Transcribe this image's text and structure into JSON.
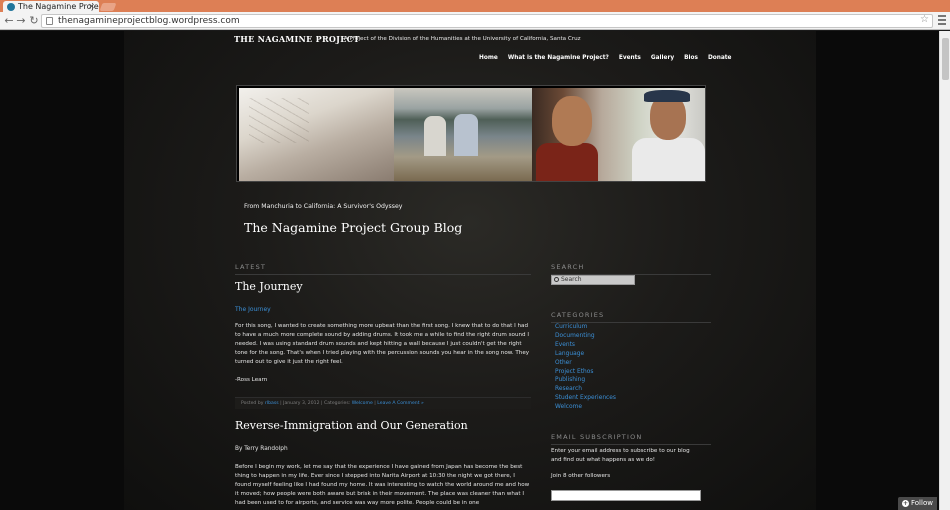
{
  "browser": {
    "tab_title": "The Nagamine Proje",
    "url": "thenagamineprojectblog.wordpress.com",
    "tab_strip_color": "#dd7f55"
  },
  "site": {
    "title": "THE NAGAMINE PROJECT",
    "description": "A Project of the Division of the Humanities at the University of California, Santa Cruz",
    "nav": [
      "Home",
      "What is the Nagamine Project?",
      "Events",
      "Gallery",
      "Bios",
      "Donate"
    ],
    "tagline": "From Manchuria to California: A Survivor's Odyssey",
    "blog_title": "The Nagamine Project Group Blog",
    "link_color": "#3b8fd6"
  },
  "main": {
    "section_label": "LATEST",
    "post1": {
      "title": "The Journey",
      "subtitle": "The Journey",
      "body": "For this song, I wanted to create something more upbeat than the first song. I knew that to do that I had to have a much more complete sound by adding drums. It took me a while to find the right drum sound I needed. I was using standard drum sounds and kept hitting a wall because I just couldn't get the right tone for the song. That's when I tried playing with the percussion sounds you hear in the song now. They turned out to give it just the right feel.",
      "signature": "-Ross Learn",
      "meta_posted_by": "Posted by",
      "meta_author": "rlbass",
      "meta_date": "January 3, 2012",
      "meta_categories_label": "Categories:",
      "meta_category": "Welcome",
      "meta_comment": "Leave A Comment »"
    },
    "post2": {
      "title": "Reverse-Immigration and Our Generation",
      "byline": "By Terry Randolph",
      "body": "Before I begin my work, let me say that the experience I have gained from Japan has become the best thing to happen in my life.  Ever since I stepped into Narita Airport at 10:30 the night we got there, I found myself feeling like I had found my home. It was interesting to watch the world around me and how it moved; how people were both aware but brisk in their movement. The place was cleaner than what I had been used to for airports, and service was way more polite. People could be in one"
    }
  },
  "sidebar": {
    "search_label": "SEARCH",
    "search_placeholder": "Search",
    "categories_label": "CATEGORIES",
    "categories": [
      "Curriculum",
      "Documenting",
      "Events",
      "Language",
      "Other",
      "Project Ethos",
      "Publishing",
      "Research",
      "Student Experiences",
      "Welcome"
    ],
    "email_label": "EMAIL SUBSCRIPTION",
    "email_text": "Enter your email address to subscribe to our blog and find out what happens as we do!",
    "join_text": "Join 8 other followers"
  },
  "follow_button": "Follow"
}
